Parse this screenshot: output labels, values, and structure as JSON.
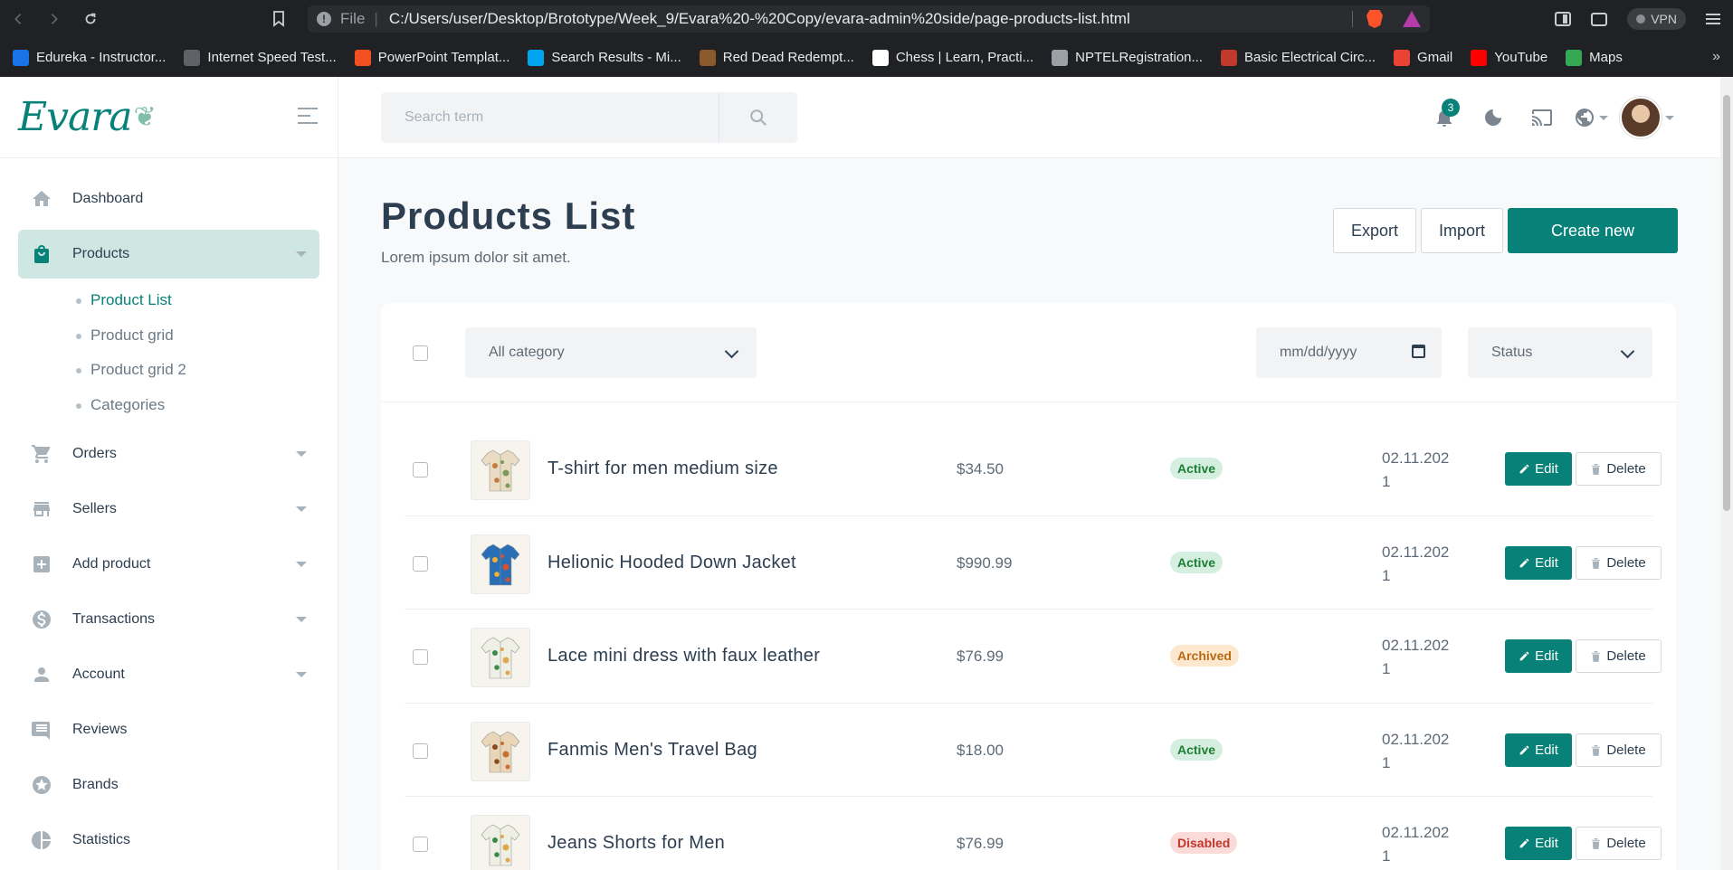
{
  "browser": {
    "file_label": "File",
    "url": "C:/Users/user/Desktop/Brototype/Week_9/Evara%20-%20Copy/evara-admin%20side/page-products-list.html",
    "vpn_label": "VPN",
    "bookmarks": [
      {
        "label": "Edureka - Instructor...",
        "icon": "edureka-icon",
        "color": "#1a73e8"
      },
      {
        "label": "Internet Speed Test...",
        "icon": "speedtest-icon",
        "color": "#5f6368"
      },
      {
        "label": "PowerPoint Templat...",
        "icon": "microsoft-icon",
        "color": "#f25022"
      },
      {
        "label": "Search Results - Mi...",
        "icon": "windows-icon",
        "color": "#00a4ef"
      },
      {
        "label": "Red Dead Redempt...",
        "icon": "rdr-icon",
        "color": "#8b5a2b"
      },
      {
        "label": "Chess | Learn, Practi...",
        "icon": "chess-icon",
        "color": "#ffffff"
      },
      {
        "label": "NPTELRegistration...",
        "icon": "globe-icon",
        "color": "#9aa0a6"
      },
      {
        "label": "Basic Electrical Circ...",
        "icon": "notion-icon",
        "color": "#c0392b"
      },
      {
        "label": "Gmail",
        "icon": "gmail-icon",
        "color": "#ea4335"
      },
      {
        "label": "YouTube",
        "icon": "youtube-icon",
        "color": "#ff0000"
      },
      {
        "label": "Maps",
        "icon": "maps-icon",
        "color": "#34a853"
      }
    ],
    "more_label": "»"
  },
  "brand": {
    "logo_text": "Evara",
    "accent": "#088178"
  },
  "sidebar": {
    "items": [
      {
        "label": "Dashboard",
        "icon": "home-icon",
        "has_caret": false
      },
      {
        "label": "Products",
        "icon": "shopping-bag-icon",
        "has_caret": true,
        "active": true
      },
      {
        "label": "Orders",
        "icon": "cart-icon",
        "has_caret": true
      },
      {
        "label": "Sellers",
        "icon": "store-icon",
        "has_caret": true
      },
      {
        "label": "Add product",
        "icon": "add-box-icon",
        "has_caret": true
      },
      {
        "label": "Transactions",
        "icon": "dollar-icon",
        "has_caret": true
      },
      {
        "label": "Account",
        "icon": "person-icon",
        "has_caret": true
      },
      {
        "label": "Reviews",
        "icon": "comment-icon",
        "has_caret": false
      },
      {
        "label": "Brands",
        "icon": "star-icon",
        "has_caret": false
      },
      {
        "label": "Statistics",
        "icon": "pie-chart-icon",
        "has_caret": false
      }
    ],
    "submenu": [
      {
        "label": "Product List",
        "current": true
      },
      {
        "label": "Product grid"
      },
      {
        "label": "Product grid 2"
      },
      {
        "label": "Categories"
      }
    ]
  },
  "topbar": {
    "search_placeholder": "Search term",
    "notification_count": "3"
  },
  "page": {
    "title": "Products List",
    "subtitle": "Lorem ipsum dolor sit amet.",
    "export_label": "Export",
    "import_label": "Import",
    "create_label": "Create new"
  },
  "filters": {
    "category": "All category",
    "date_placeholder": "mm/dd/yyyy",
    "status": "Status"
  },
  "products": [
    {
      "name": "T-shirt for men medium size",
      "price": "$34.50",
      "status": "Active",
      "status_class": "st-active",
      "date": "02.11.2021",
      "thumb": "shirt-floral-beige"
    },
    {
      "name": "Helionic Hooded Down Jacket",
      "price": "$990.99",
      "status": "Active",
      "status_class": "st-active",
      "date": "02.11.2021",
      "thumb": "shirt-colorful"
    },
    {
      "name": "Lace mini dress with faux leather",
      "price": "$76.99",
      "status": "Archived",
      "status_class": "st-archived",
      "date": "02.11.2021",
      "thumb": "shirt-green-leaf"
    },
    {
      "name": "Fanmis Men's Travel Bag",
      "price": "$18.00",
      "status": "Active",
      "status_class": "st-active",
      "date": "02.11.2021",
      "thumb": "shirt-floral-brown"
    },
    {
      "name": "Jeans Shorts for Men",
      "price": "$76.99",
      "status": "Disabled",
      "status_class": "st-disabled",
      "date": "02.11.2021",
      "thumb": "shirt-green-leaf"
    }
  ],
  "row_actions": {
    "edit_label": "Edit",
    "delete_label": "Delete"
  }
}
